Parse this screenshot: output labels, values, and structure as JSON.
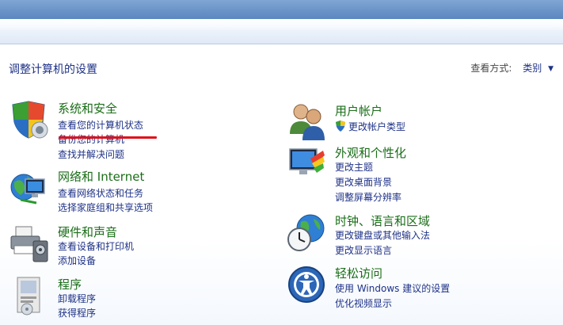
{
  "header": {
    "page_title": "调整计算机的设置",
    "view_by_label": "查看方式:",
    "view_by_value": "类别"
  },
  "left_column": [
    {
      "icon": "shield-icon",
      "title": "系统和安全",
      "links": [
        "查看您的计算机状态",
        "备份您的计算机",
        "查找并解决问题"
      ]
    },
    {
      "icon": "network-globe-icon",
      "title": "网络和 Internet",
      "links": [
        "查看网络状态和任务",
        "选择家庭组和共享选项"
      ]
    },
    {
      "icon": "printer-icon",
      "title": "硬件和声音",
      "links": [
        "查看设备和打印机",
        "添加设备"
      ]
    },
    {
      "icon": "program-box-icon",
      "title": "程序",
      "links": [
        "卸载程序",
        "获得程序"
      ]
    }
  ],
  "right_column": [
    {
      "icon": "users-icon",
      "title": "用户帐户",
      "links": [
        "更改帐户类型"
      ]
    },
    {
      "icon": "display-paint-icon",
      "title": "外观和个性化",
      "links": [
        "更改主题",
        "更改桌面背景",
        "调整屏幕分辨率"
      ]
    },
    {
      "icon": "clock-globe-icon",
      "title": "时钟、语言和区域",
      "links": [
        "更改键盘或其他输入法",
        "更改显示语言"
      ]
    },
    {
      "icon": "accessibility-icon",
      "title": "轻松访问",
      "links": [
        "使用 Windows 建议的设置",
        "优化视频显示"
      ]
    }
  ],
  "colors": {
    "link": "#1e3287",
    "category_title": "#1a6e18",
    "highlight_underline": "#e0101a"
  }
}
